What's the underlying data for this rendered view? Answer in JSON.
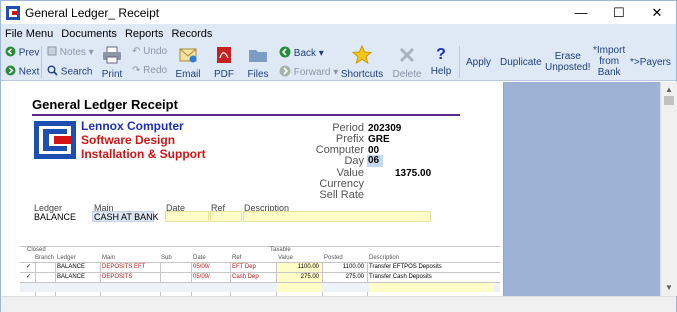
{
  "window": {
    "title": "General Ledger_ Receipt"
  },
  "menu": [
    "File Menu",
    "Documents",
    "Reports",
    "Records"
  ],
  "toolbar": {
    "prev": "Prev",
    "next": "Next",
    "notes": "Notes",
    "search": "Search",
    "undo": "Undo",
    "redo": "Redo",
    "print": "Print",
    "email": "Email",
    "pdf": "PDF",
    "files": "Files",
    "back": "Back",
    "forward": "Forward",
    "shortcuts": "Shortcuts",
    "delete": "Delete",
    "help": "Help",
    "apply": "Apply",
    "duplicate": "Duplicate",
    "erase_line1": "Erase",
    "erase_line2": "Unposted!",
    "import_line1": "*Import",
    "import_line2": "from",
    "import_line3": "Bank",
    "payers": "*>Payers"
  },
  "document": {
    "title": "General Ledger Receipt",
    "company": [
      "Lennox Computer",
      "Software Design",
      "Installation & Support"
    ],
    "fields": {
      "period_label": "Period",
      "period": "202309",
      "prefix_label": "Prefix",
      "prefix": "GRE",
      "computer_label": "Computer",
      "computer": "00",
      "day_label": "Day",
      "day": "06",
      "value_label": "Value",
      "value": "1375.00",
      "currency_label": "Currency",
      "sellrate_label": "Sell Rate"
    },
    "header_row": {
      "ledger_label": "Ledger",
      "ledger": "BALANCE",
      "main_label": "Main",
      "main": "CASH AT BANK",
      "date_label": "Date",
      "ref_label": "Ref",
      "description_label": "Description"
    },
    "table": {
      "top_headers": {
        "closed": "Closed",
        "taxable": "Taxable"
      },
      "columns": [
        "Branch",
        "Ledger",
        "Main",
        "Sub",
        "Date",
        "Ref",
        "Value",
        "Posted",
        "Description"
      ],
      "rows": [
        {
          "check": "✓",
          "ledger": "BALANCE",
          "main": "DEPOSITS EFT",
          "sub": "",
          "date": "05/09/",
          "ref": "EFT Dep",
          "value": "1100.00",
          "posted": "1100.00",
          "description": "Transfer EFTPOS Deposits"
        },
        {
          "check": "✓",
          "ledger": "BALANCE",
          "main": "DEPOSITS",
          "sub": "",
          "date": "05/09/",
          "ref": "Cash Dep",
          "value": "275.00",
          "posted": "275.00",
          "description": "Transfer Cash Deposits"
        }
      ]
    }
  },
  "colors": {
    "menu_bg": "#dfe9f5",
    "side_panel": "#9db2d4",
    "company_blue": "#1d2fb8",
    "company_red": "#d41414",
    "field_yellow": "#fffdc7"
  }
}
